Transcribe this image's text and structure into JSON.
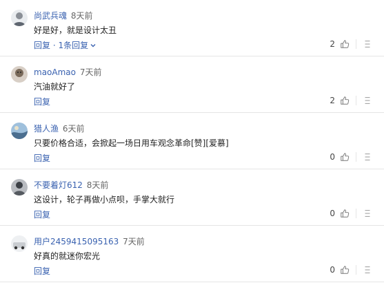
{
  "comments": [
    {
      "username": "尚武兵魂",
      "time": "8天前",
      "text": "好是好，就是设计太丑",
      "reply_label": "回复",
      "expand_label": "· 1条回复",
      "likes": "2",
      "avatar_color": "#8a8f96"
    },
    {
      "username": "maoAmao",
      "time": "7天前",
      "text": "汽油就好了",
      "reply_label": "回复",
      "expand_label": "",
      "likes": "2",
      "avatar_color": "#7a6a5a"
    },
    {
      "username": "猎人渔",
      "time": "6天前",
      "text": "只要价格合适，会掀起一场日用车观念革命[赞][爱慕]",
      "reply_label": "回复",
      "expand_label": "",
      "likes": "0",
      "avatar_color": "#4b6e8f"
    },
    {
      "username": "不要着灯612",
      "time": "8天前",
      "text": "这设计，轮子再做小点呗，手掌大就行",
      "reply_label": "回复",
      "expand_label": "",
      "likes": "0",
      "avatar_color": "#555a60"
    },
    {
      "username": "用户2459415095163",
      "time": "7天前",
      "text": "好真的就迷你宏光",
      "reply_label": "回复",
      "expand_label": "",
      "likes": "0",
      "avatar_color": "#c9ccd0"
    }
  ],
  "icons": {
    "like": "thumbs-up-icon",
    "more": "more-icon",
    "chevron": "chevron-down-icon"
  }
}
